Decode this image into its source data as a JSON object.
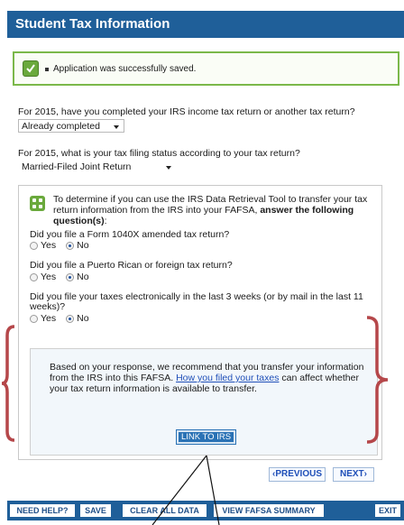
{
  "header": {
    "title": "Student Tax Information"
  },
  "notice": {
    "message": "Application was successfully saved."
  },
  "q_return": {
    "question": "For 2015, have you completed your IRS income tax return or another tax return?",
    "selected": "Already completed"
  },
  "q_status": {
    "question": "For 2015, what is your tax filing status according to your tax return?",
    "selected": "Married-Filed Joint Return"
  },
  "drt": {
    "intro_plain": "To determine if you can use the IRS Data Retrieval Tool to transfer your tax return information from the IRS into your FAFSA, ",
    "intro_bold": "answer the following question(s)",
    "intro_end": ":",
    "questions": [
      {
        "text": "Did you file a Form 1040X amended tax return?",
        "yes": "Yes",
        "no": "No",
        "selected": "No"
      },
      {
        "text": "Did you file a Puerto Rican or foreign tax return?",
        "yes": "Yes",
        "no": "No",
        "selected": "No"
      },
      {
        "text": "Did you file your taxes electronically in the last 3 weeks (or by mail in the last 11 weeks)?",
        "yes": "Yes",
        "no": "No",
        "selected": "No"
      }
    ]
  },
  "recommendation": {
    "text_before": "Based on your response, we recommend that you transfer your information from the IRS into this FAFSA. ",
    "link": "How you filed your taxes",
    "text_after": " can affect whether your tax return information is available to transfer.",
    "button": "LINK TO IRS"
  },
  "nav": {
    "previous": "PREVIOUS",
    "next": "NEXT"
  },
  "footer": {
    "help": "NEED HELP?",
    "save": "SAVE",
    "clear": "CLEAR ALL DATA",
    "summary": "VIEW FAFSA SUMMARY",
    "exit": "EXIT"
  },
  "colors": {
    "header": "#1f5f99",
    "success_border": "#7bb84a",
    "brace": "#b5474a",
    "link": "#1f4fb8"
  }
}
